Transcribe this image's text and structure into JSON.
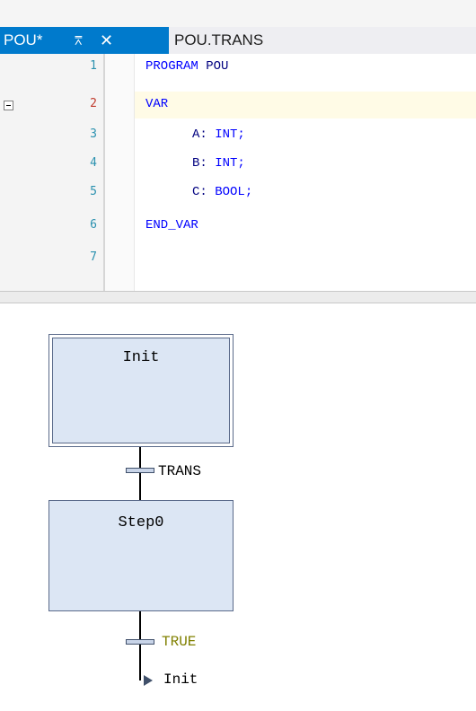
{
  "tabs": [
    {
      "label": "POU*",
      "pin_icon": "pin-icon",
      "close_icon": "close-icon",
      "active": true
    },
    {
      "label": "POU.TRANS",
      "active": false
    }
  ],
  "editor": {
    "line_numbers": [
      "1",
      "2",
      "3",
      "4",
      "5",
      "6",
      "7"
    ],
    "lines": [
      {
        "kw": "PROGRAM",
        "rest": " POU"
      },
      {
        "kw": "VAR",
        "rest": ""
      },
      {
        "name": "A:",
        "type": "INT;"
      },
      {
        "name": "B:",
        "type": "INT;"
      },
      {
        "name": "C:",
        "type": "BOOL;"
      },
      {
        "kw": "END_VAR",
        "rest": ""
      },
      {
        "kw": "",
        "rest": ""
      }
    ]
  },
  "sfc": {
    "steps": [
      {
        "name": "Init",
        "initial": true
      },
      {
        "name": "Step0",
        "initial": false
      }
    ],
    "transitions": [
      {
        "label": "TRANS",
        "color": "#000000"
      },
      {
        "label": "TRUE",
        "color": "#808000"
      }
    ],
    "jump": {
      "target": "Init"
    }
  },
  "colors": {
    "accent": "#007acc",
    "step_fill": "#dce6f4"
  }
}
